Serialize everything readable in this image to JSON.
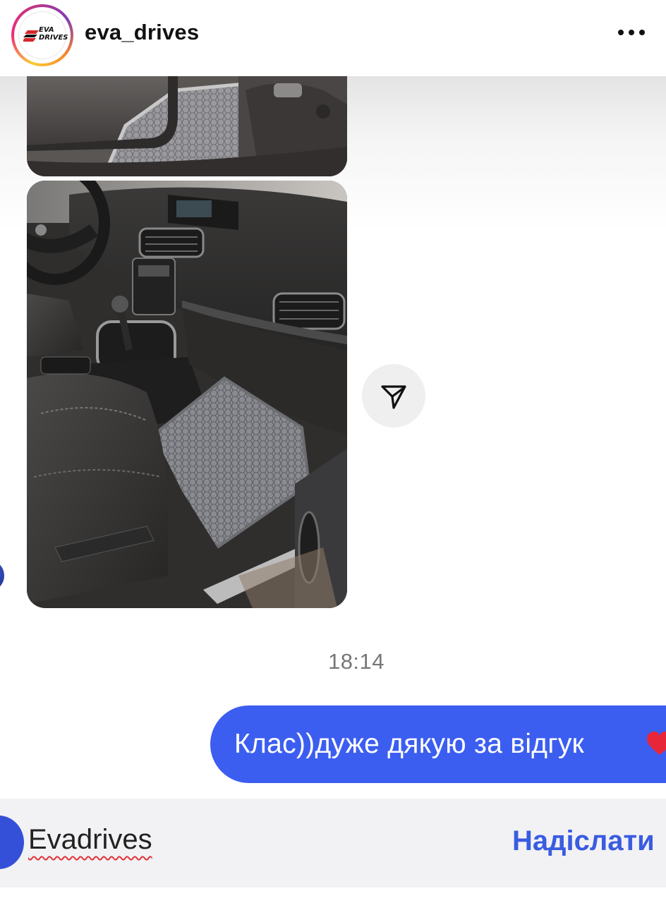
{
  "header": {
    "username": "eva_drives",
    "logo_text_top": "EVA",
    "logo_text_bottom": "DRIVES",
    "more_icon": "more-horizontal-icon"
  },
  "messages": [
    {
      "type": "image",
      "from": "them",
      "content": "car floor mat photo"
    },
    {
      "type": "image",
      "from": "them",
      "content": "car interior with grey EVA floor mat"
    },
    {
      "type": "timestamp",
      "text": "18:14"
    },
    {
      "type": "text",
      "from": "me",
      "text": "Клас))дуже дякую за відгук"
    }
  ],
  "share_icon": "paper-plane-icon",
  "composer": {
    "input_value": "Evadrives",
    "send_label": "Надіслати"
  },
  "colors": {
    "bubble": "#3c5ef0",
    "send": "#3a5ce0",
    "timestamp": "#777777"
  }
}
